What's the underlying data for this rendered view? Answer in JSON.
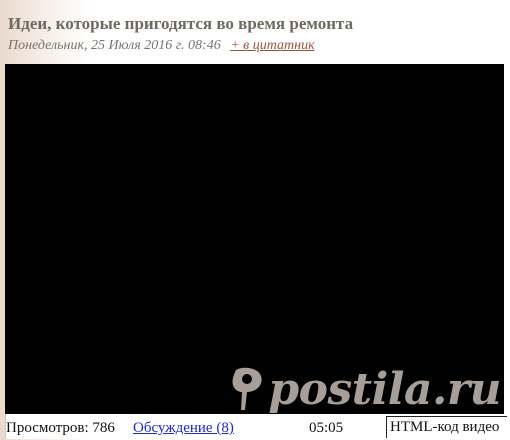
{
  "post": {
    "title": "Идеи, которые пригодятся во время ремонта",
    "date": "Понедельник, 25 Июля 2016 г. 08:46",
    "quote_link": "+ в цитатник"
  },
  "watermark": {
    "text": "postila.ru",
    "icon": "pin-icon"
  },
  "video_bar": {
    "views": "Просмотров: 786",
    "discussion": "Обсуждение (8)",
    "duration": "05:05",
    "embed_code": "HTML-код видео"
  }
}
